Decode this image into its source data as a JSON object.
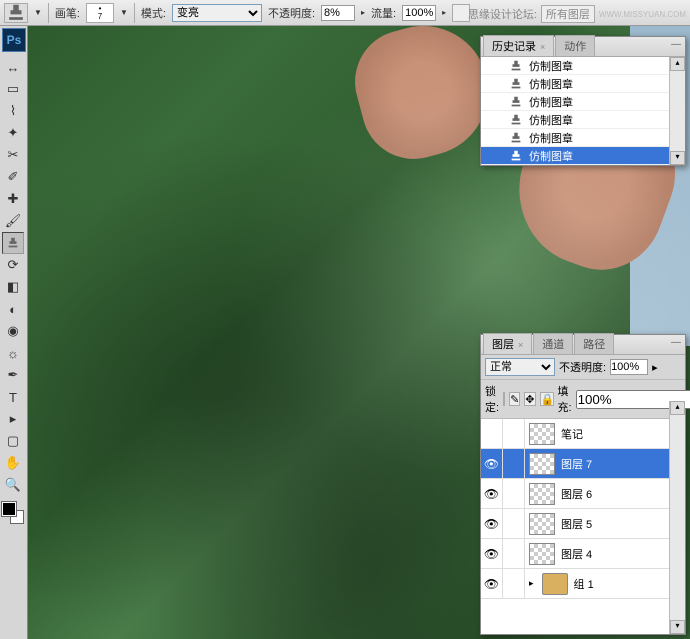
{
  "options_bar": {
    "brush_label": "画笔:",
    "brush_size": "7",
    "mode_label": "模式:",
    "mode_value": "变亮",
    "opacity_label": "不透明度:",
    "opacity_value": "8%",
    "flow_label": "流量:",
    "flow_value": "100%"
  },
  "watermark": {
    "text1": "思缘设计论坛:",
    "text2": "所有图层",
    "site": "WWW.MISSYUAN.COM"
  },
  "history": {
    "tab_history": "历史记录",
    "tab_actions": "动作",
    "items": [
      "仿制图章",
      "仿制图章",
      "仿制图章",
      "仿制图章",
      "仿制图章",
      "仿制图章"
    ]
  },
  "layers": {
    "tab_layers": "图层",
    "tab_channels": "通道",
    "tab_paths": "路径",
    "blend_mode": "正常",
    "opacity_label": "不透明度:",
    "opacity_value": "100%",
    "lock_label": "锁定:",
    "fill_label": "填充:",
    "fill_value": "100%",
    "rows": [
      {
        "name": "笔记",
        "visible": false,
        "type": "layer"
      },
      {
        "name": "图层 7",
        "visible": true,
        "type": "layer",
        "selected": true
      },
      {
        "name": "图层 6",
        "visible": true,
        "type": "layer"
      },
      {
        "name": "图层 5",
        "visible": true,
        "type": "layer"
      },
      {
        "name": "图层 4",
        "visible": true,
        "type": "layer"
      },
      {
        "name": "组 1",
        "visible": true,
        "type": "group"
      }
    ]
  },
  "tools": [
    "move",
    "marquee",
    "lasso",
    "wand",
    "crop",
    "eyedropper",
    "healing",
    "brush",
    "stamp",
    "history-brush",
    "eraser",
    "gradient",
    "blur",
    "dodge",
    "pen",
    "type",
    "path-select",
    "rectangle",
    "hand",
    "zoom"
  ]
}
